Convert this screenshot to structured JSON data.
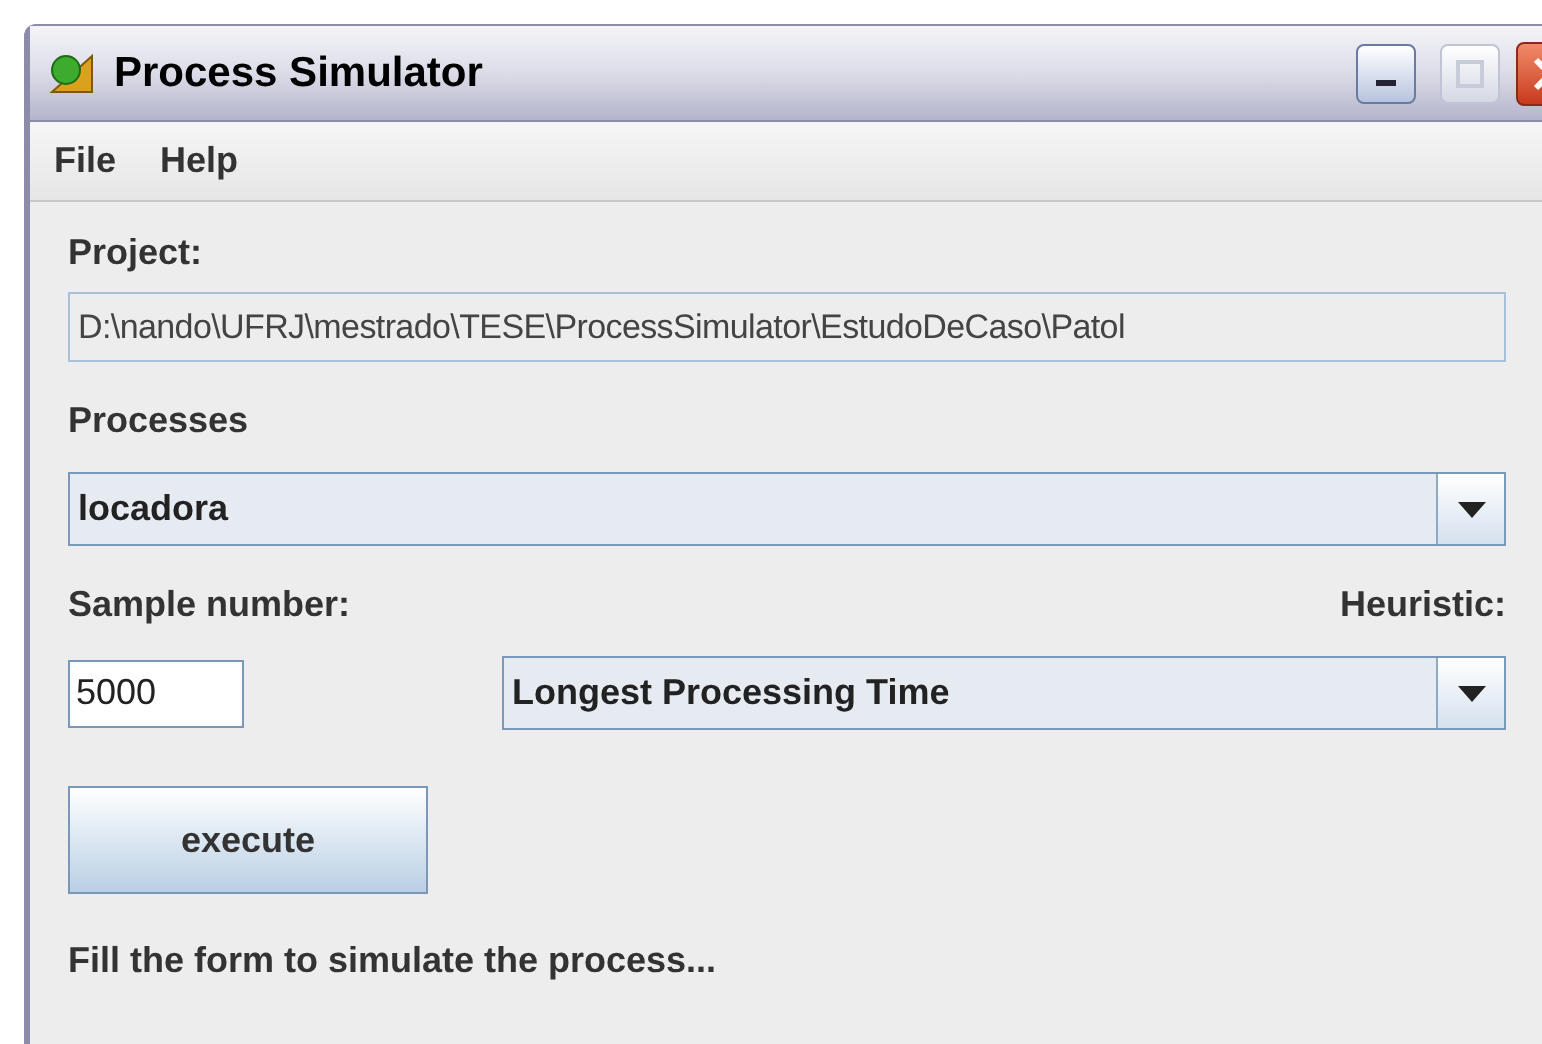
{
  "window": {
    "title": "Process Simulator"
  },
  "menu": [
    "File",
    "Help"
  ],
  "project": {
    "label": "Project:",
    "value": "D:\\nando\\UFRJ\\mestrado\\TESE\\ProcessSimulator\\EstudoDeCaso\\Patol"
  },
  "processes": {
    "label": "Processes",
    "value": "locadora"
  },
  "sample": {
    "label": "Sample number:",
    "value": "5000"
  },
  "heuristic": {
    "label": "Heuristic:",
    "value": "Longest Processing Time"
  },
  "button": "execute",
  "status": "Fill the form to simulate the process..."
}
